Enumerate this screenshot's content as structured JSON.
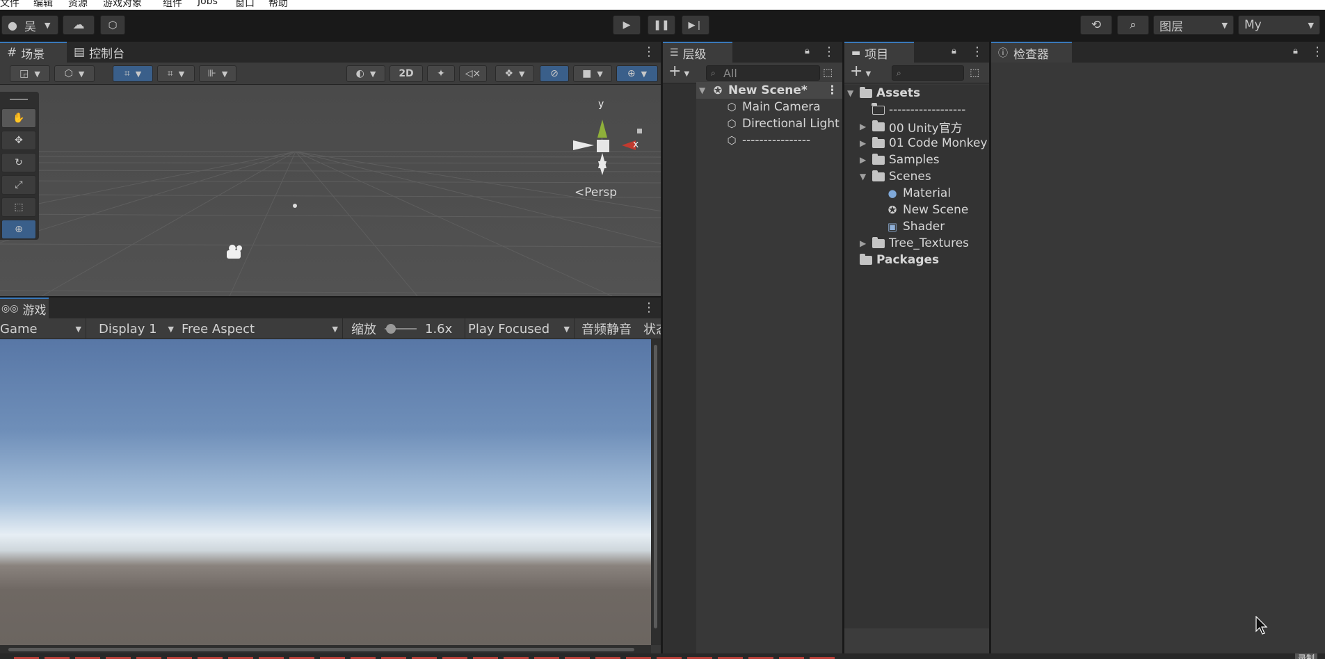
{
  "menubar": {
    "items": [
      "文件",
      "编辑",
      "资源",
      "游戏对象",
      "组件",
      "Jobs",
      "窗口",
      "帮助"
    ]
  },
  "toolbar": {
    "account_label": "吴",
    "layers_label": "图层",
    "layout_label": "My"
  },
  "scene_panel": {
    "tabs": [
      "场景",
      "控制台"
    ],
    "mode_2d": "2D",
    "gizmo_y": "y",
    "gizmo_x": "x",
    "persp_label": "<Persp"
  },
  "game_panel": {
    "tab": "游戏",
    "display_mode": "Game",
    "display": "Display 1",
    "aspect": "Free Aspect",
    "scale_label": "缩放",
    "scale_value": "1.6x",
    "play_focused": "Play Focused",
    "mute": "音频静音",
    "stats": "状态"
  },
  "hierarchy": {
    "tab": "层级",
    "search_placeholder": "All",
    "scene_name": "New Scene*",
    "items": [
      "Main Camera",
      "Directional Light",
      "----------------"
    ]
  },
  "project": {
    "tab": "项目",
    "tree": [
      {
        "label": "Assets",
        "level": 0,
        "type": "open-folder",
        "bold": true
      },
      {
        "label": "------------------",
        "level": 1,
        "type": "empty-folder"
      },
      {
        "label": "00 Unity官方",
        "level": 1,
        "type": "folder",
        "arrow": "right"
      },
      {
        "label": "01 Code Monkey",
        "level": 1,
        "type": "folder",
        "arrow": "right"
      },
      {
        "label": "Samples",
        "level": 1,
        "type": "folder",
        "arrow": "right"
      },
      {
        "label": "Scenes",
        "level": 1,
        "type": "open-folder",
        "arrow": "down"
      },
      {
        "label": "Material",
        "level": 2,
        "type": "material"
      },
      {
        "label": "New Scene",
        "level": 2,
        "type": "scene"
      },
      {
        "label": "Shader",
        "level": 2,
        "type": "shader"
      },
      {
        "label": "Tree_Textures",
        "level": 1,
        "type": "folder",
        "arrow": "right"
      },
      {
        "label": "Packages",
        "level": 0,
        "type": "folder",
        "bold": true
      }
    ]
  },
  "inspector": {
    "tab": "检查器"
  },
  "status": {
    "corner_label": "录制"
  },
  "colors": {
    "accent": "#3a79bb",
    "panel": "#383838",
    "background": "#191919",
    "sky_top": "#5c7fae",
    "ground": "#6e6561"
  }
}
